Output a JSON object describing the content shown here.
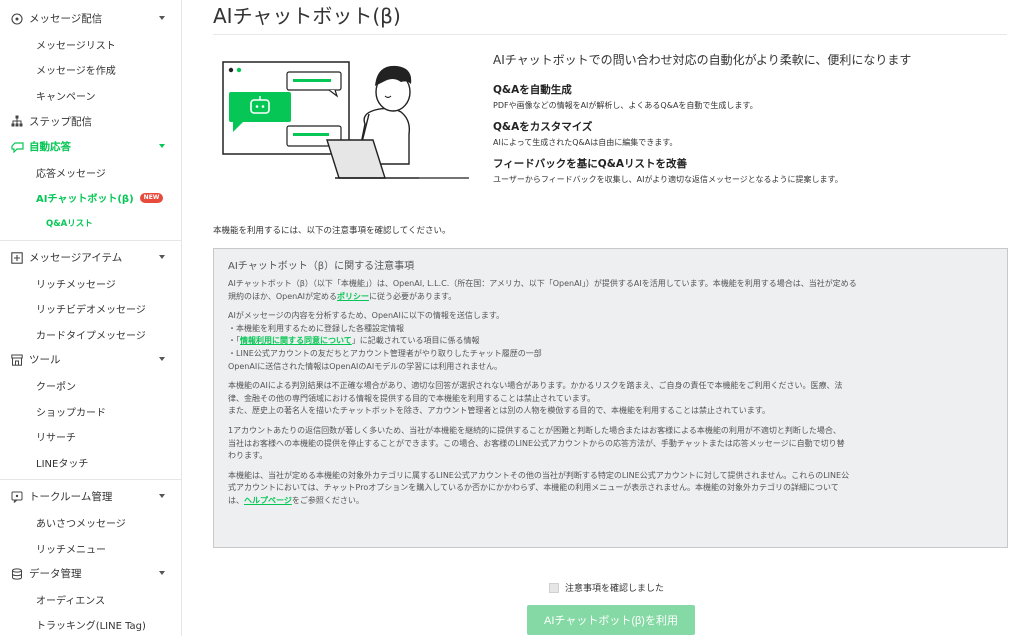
{
  "sidebar": {
    "message_delivery": {
      "label": "メッセージ配信",
      "items": [
        "メッセージリスト",
        "メッセージを作成",
        "キャンペーン"
      ]
    },
    "step_delivery": {
      "label": "ステップ配信"
    },
    "auto_reply": {
      "label": "自動応答",
      "items": [
        "応答メッセージ",
        "AIチャットボット(β)"
      ],
      "badge": "NEW",
      "subitem": "Q&Aリスト"
    },
    "message_items": {
      "label": "メッセージアイテム",
      "items": [
        "リッチメッセージ",
        "リッチビデオメッセージ",
        "カードタイプメッセージ"
      ]
    },
    "tools": {
      "label": "ツール",
      "items": [
        "クーポン",
        "ショップカード",
        "リサーチ",
        "LINEタッチ"
      ]
    },
    "chat_room": {
      "label": "トークルーム管理",
      "items": [
        "あいさつメッセージ",
        "リッチメニュー"
      ]
    },
    "data_mgmt": {
      "label": "データ管理",
      "items": [
        "オーディエンス",
        "トラッキング(LINE Tag)"
      ]
    }
  },
  "main": {
    "title": "AIチャットボット(β)",
    "lead": "AIチャットボットでの問い合わせ対応の自動化がより柔軟に、便利になります",
    "features": [
      {
        "title": "Q&Aを自動生成",
        "desc": "PDFや画像などの情報をAIが解析し、よくあるQ&Aを自動で生成します。"
      },
      {
        "title": "Q&Aをカスタマイズ",
        "desc": "AIによって生成されたQ&Aは自由に編集できます。"
      },
      {
        "title": "フィードバックを基にQ&Aリストを改善",
        "desc": "ユーザーからフィードバックを収集し、AIがより適切な返信メッセージとなるように提案します。"
      }
    ],
    "intro": "本機能を利用するには、以下の注意事項を確認してください。",
    "notice": {
      "heading": "AIチャットボット（β）に関する注意事項",
      "p1_a": "AIチャットボット（β）（以下「本機能」）は、OpenAI, L.L.C.（所在国：アメリカ、以下「OpenAI」）が提供するAIを活用しています。本機能を利用する場合は、当社が定める",
      "p1_b": "規約のほか、OpenAIが定める",
      "p1_link": "ポリシー",
      "p1_c": "に従う必要があります。",
      "p2_l1": "AIがメッセージの内容を分析するため、OpenAIに以下の情報を送信します。",
      "p2_l2": "・本機能を利用するために登録した各種設定情報",
      "p2_l3_a": "・「",
      "p2_l3_link": "情報利用に関する同意について",
      "p2_l3_b": "」に記載されている項目に係る情報",
      "p2_l4": "・LINE公式アカウントの友だちとアカウント管理者がやり取りしたチャット履歴の一部",
      "p2_l5": "OpenAIに送信された情報はOpenAIのAIモデルの学習には利用されません。",
      "p3_l1": "本機能のAIによる判別結果は不正確な場合があり、適切な回答が選択されない場合があります。かかるリスクを踏まえ、ご自身の責任で本機能をご利用ください。医療、法",
      "p3_l2": "律、金融その他の専門領域における情報を提供する目的で本機能を利用することは禁止されています。",
      "p3_l3": "また、歴史上の著名人を描いたチャットボットを除き、アカウント管理者とは別の人物を模倣する目的で、本機能を利用することは禁止されています。",
      "p4_l1": "1アカウントあたりの返信回数が著しく多いため、当社が本機能を継続的に提供することが困難と判断した場合またはお客様による本機能の利用が不適切と判断した場合、",
      "p4_l2": "当社はお客様への本機能の提供を停止することができます。この場合、お客様のLINE公式アカウントからの応答方法が、手動チャットまたは応答メッセージに自動で切り替",
      "p4_l3": "わります。",
      "p5_l1": "本機能は、当社が定める本機能の対象外カテゴリに属するLINE公式アカウントその他の当社が判断する特定のLINE公式アカウントに対して提供されません。これらのLINE公",
      "p5_l2": "式アカウントにおいては、チャットProオプションを購入しているか否かにかかわらず、本機能の利用メニューが表示されません。本機能の対象外カテゴリの詳細について",
      "p5_l3_a": "は、",
      "p5_l3_link": "ヘルプページ",
      "p5_l3_b": "をご参照ください。"
    },
    "confirm_label": "注意事項を確認しました",
    "use_button": "AIチャットボット(β)を利用"
  },
  "colors": {
    "brand": "#06c755",
    "button_disabled": "#85d9a4",
    "notice_bg": "#eeeff0",
    "badge": "#e84b3c"
  },
  "icons": [
    "broadcast-icon",
    "sitemap-icon",
    "chat-bubble-icon",
    "plus-square-icon",
    "store-icon",
    "chat-room-icon",
    "database-icon",
    "chevron-down-icon"
  ]
}
